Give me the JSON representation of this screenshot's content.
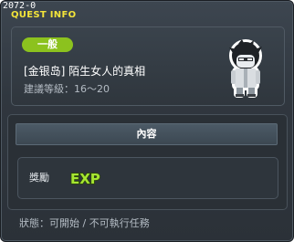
{
  "window": {
    "build_id": "2072-0",
    "title": "QUEST INFO"
  },
  "quest": {
    "level_badge": "一般",
    "name": "[金银岛] 陌生女人的真相",
    "requirement": "建議等級：16～20",
    "npc_icon": "npc-portrait-icon"
  },
  "content": {
    "header": "內容",
    "reward_label": "獎勵",
    "reward_icon_text": "EXP"
  },
  "status": {
    "text": "狀態：可開始 / 不可執行任務"
  },
  "colors": {
    "title": "#f3e43a",
    "badge": "#8cc21e",
    "exp": "#a6e632"
  }
}
